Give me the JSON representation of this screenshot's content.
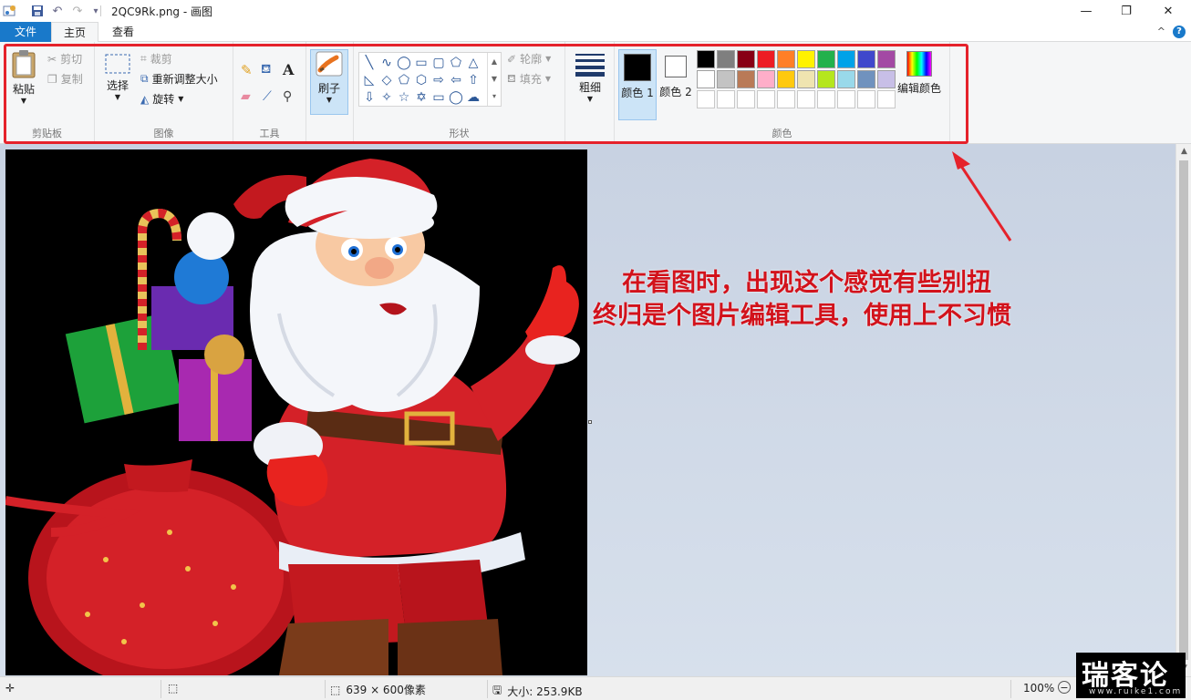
{
  "window": {
    "title": "2QC9Rk.png - 画图",
    "minimize": "—",
    "maximize": "❐",
    "close": "✕"
  },
  "tabs": {
    "file": "文件",
    "home": "主页",
    "view": "查看",
    "collapse": "^",
    "help": "?"
  },
  "ribbon": {
    "clipboard": {
      "group": "剪贴板",
      "paste": "粘贴",
      "cut": "剪切",
      "copy": "复制"
    },
    "image": {
      "group": "图像",
      "select": "选择",
      "crop": "裁剪",
      "resize": "重新调整大小",
      "rotate": "旋转"
    },
    "tools": {
      "group": "工具"
    },
    "brushes": {
      "label": "刷子"
    },
    "shapes": {
      "group": "形状",
      "outline": "轮廓",
      "fill": "填充"
    },
    "size": {
      "label": "粗细"
    },
    "colors": {
      "group": "颜色",
      "color1": "颜色 1",
      "color2": "颜色 2",
      "edit": "编辑颜色",
      "row1": [
        "#000000",
        "#7f7f7f",
        "#880015",
        "#ed1c24",
        "#ff7f27",
        "#fff200",
        "#22b14c",
        "#00a2e8",
        "#3f48cc",
        "#a349a4"
      ],
      "row2": [
        "#ffffff",
        "#c3c3c3",
        "#b97a57",
        "#ffaec9",
        "#ffc90e",
        "#efe4b0",
        "#b5e61d",
        "#99d9ea",
        "#7092be",
        "#c8bfe7"
      ]
    }
  },
  "annotation": {
    "line1": "在看图时，出现这个感觉有些别扭",
    "line2": "终归是个图片编辑工具，使用上不习惯"
  },
  "status": {
    "dimensions": "639 × 600像素",
    "size": "大小: 253.9KB",
    "zoom": "100%"
  },
  "watermark": {
    "big": "瑞客论坛",
    "small": "www.ruike1.com"
  }
}
